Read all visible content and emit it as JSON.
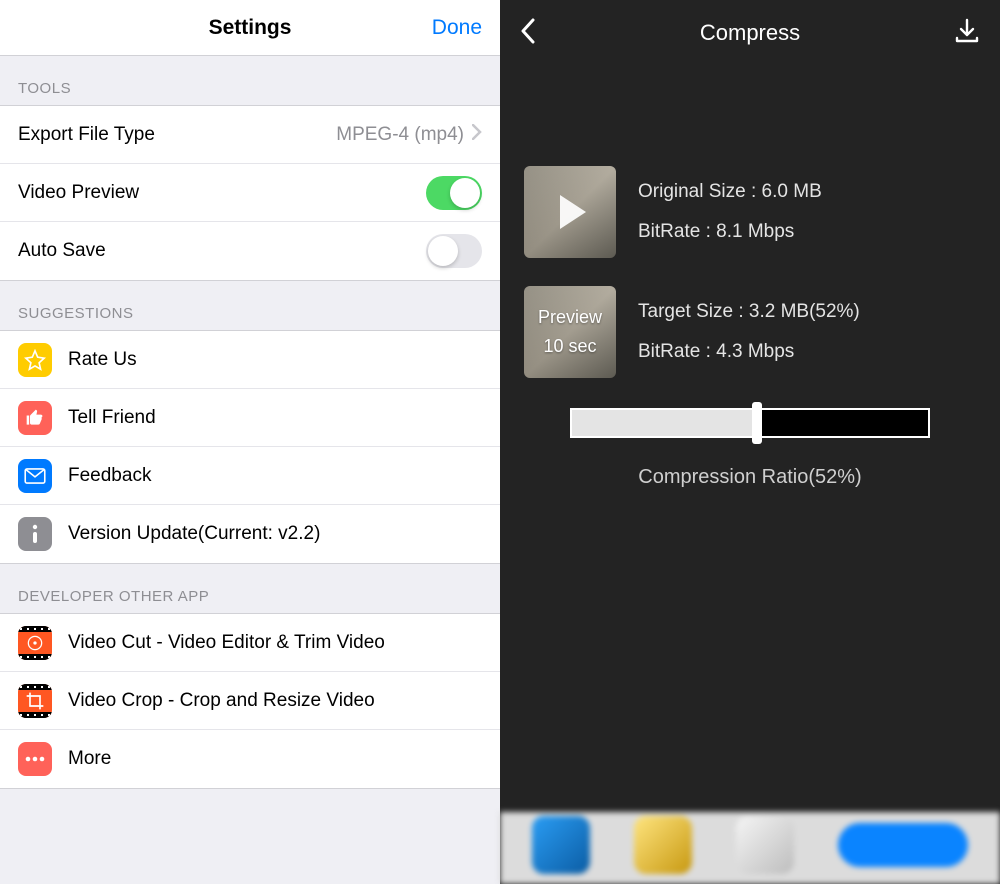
{
  "left": {
    "title": "Settings",
    "done": "Done",
    "sections": {
      "tools": {
        "header": "TOOLS",
        "export_label": "Export File Type",
        "export_value": "MPEG-4 (mp4)",
        "preview_label": "Video Preview",
        "autosave_label": "Auto Save"
      },
      "suggestions": {
        "header": "SUGGESTIONS",
        "rate": "Rate Us",
        "tell": "Tell Friend",
        "feedback": "Feedback",
        "version": "Version Update(Current: v2.2)"
      },
      "other": {
        "header": "DEVELOPER OTHER APP",
        "cut": "Video Cut - Video Editor & Trim Video",
        "crop": "Video Crop - Crop and Resize Video",
        "more": "More"
      }
    }
  },
  "right": {
    "title": "Compress",
    "original_size": "Original Size : 6.0 MB",
    "original_bitrate": "BitRate : 8.1 Mbps",
    "preview_line1": "Preview",
    "preview_line2": "10 sec",
    "target_size": "Target Size : 3.2 MB(52%)",
    "target_bitrate": "BitRate : 4.3 Mbps",
    "ratio_label": "Compression Ratio(52%)",
    "ratio_percent": 52
  }
}
